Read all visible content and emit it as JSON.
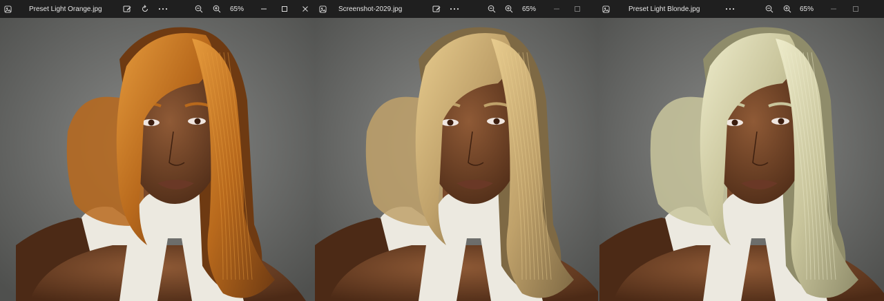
{
  "windows": [
    {
      "title": "Preset Light Orange.jpg",
      "zoom": "65%",
      "hair": {
        "light": "#e59a3c",
        "mid": "#b8691c",
        "dark": "#6e3a12",
        "shadow": "#4a2408"
      },
      "icons": [
        "photo-app-icon",
        "edit-icon",
        "rotate-icon",
        "more-icon",
        "zoom-out-icon",
        "zoom-in-icon",
        "minimize-icon",
        "maximize-icon",
        "close-icon"
      ]
    },
    {
      "title": "Screenshot-2029.jpg",
      "zoom": "65%",
      "hair": {
        "light": "#e8cc8e",
        "mid": "#bfa16a",
        "dark": "#7e6944",
        "shadow": "#55462c"
      },
      "icons": [
        "photo-app-icon",
        "edit-icon",
        "more-icon",
        "zoom-out-icon",
        "zoom-in-icon",
        "minimize-icon",
        "maximize-icon"
      ]
    },
    {
      "title": "Preset Light Blonde.jpg",
      "zoom": "65%",
      "hair": {
        "light": "#eeeccb",
        "mid": "#c9c59c",
        "dark": "#8f8c6a",
        "shadow": "#63614a"
      },
      "icons": [
        "photo-app-icon",
        "more-icon",
        "zoom-out-icon",
        "zoom-in-icon",
        "minimize-icon",
        "maximize-icon"
      ]
    }
  ],
  "colors": {
    "titlebar": "#1f1f1f",
    "background": "#6f706e",
    "skin": "#7a4a2c",
    "skin_shadow": "#4c2a16",
    "garment": "#ece9e0"
  }
}
